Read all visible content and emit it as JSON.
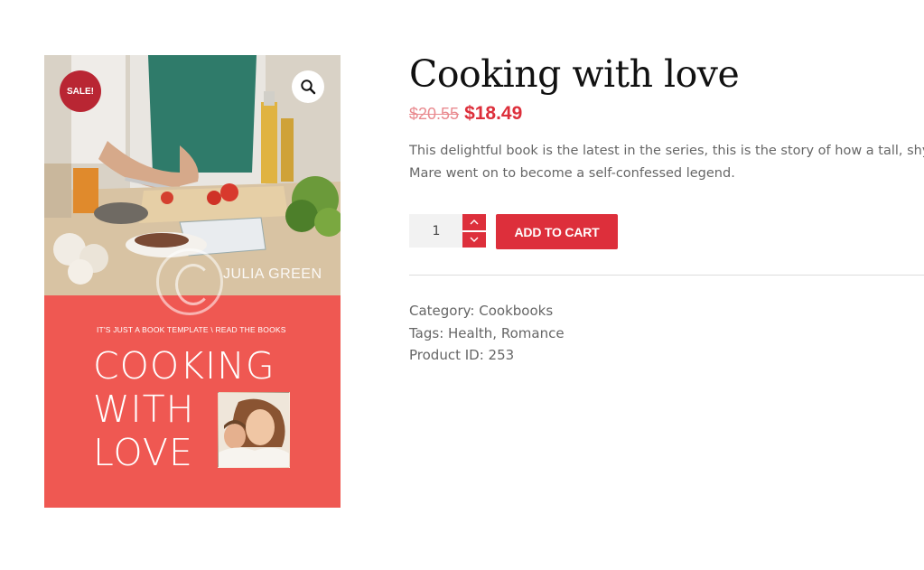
{
  "product": {
    "sale_badge": "SALE!",
    "zoom_icon": "magnifier-icon",
    "cover": {
      "author": "JULIA GREEN",
      "tagline": "IT'S JUST A BOOK TEMPLATE   \\ READ THE BOOKS",
      "title_lines": [
        "COOKING",
        "WITH",
        "LOVE"
      ]
    },
    "title": "Cooking with love",
    "price_old": "$20.55",
    "price_new": "$18.49",
    "description_line1": "This delightful book is the latest in the series, this is the story of how a tall, shy",
    "description_line2": "Mare went on to become a self-confessed legend.",
    "quantity": "1",
    "add_to_cart": "ADD TO CART",
    "meta": {
      "category_label": "Category:",
      "category_value": "Cookbooks",
      "tags_label": "Tags:",
      "tags": [
        "Health",
        "Romance"
      ],
      "tags_separator": ",",
      "id_label": "Product ID:",
      "id_value": "253"
    }
  },
  "colors": {
    "accent": "#dd2f3b",
    "sale_badge": "#b92633",
    "price_old": "#e98a8f",
    "cover_red": "#ef5852"
  }
}
